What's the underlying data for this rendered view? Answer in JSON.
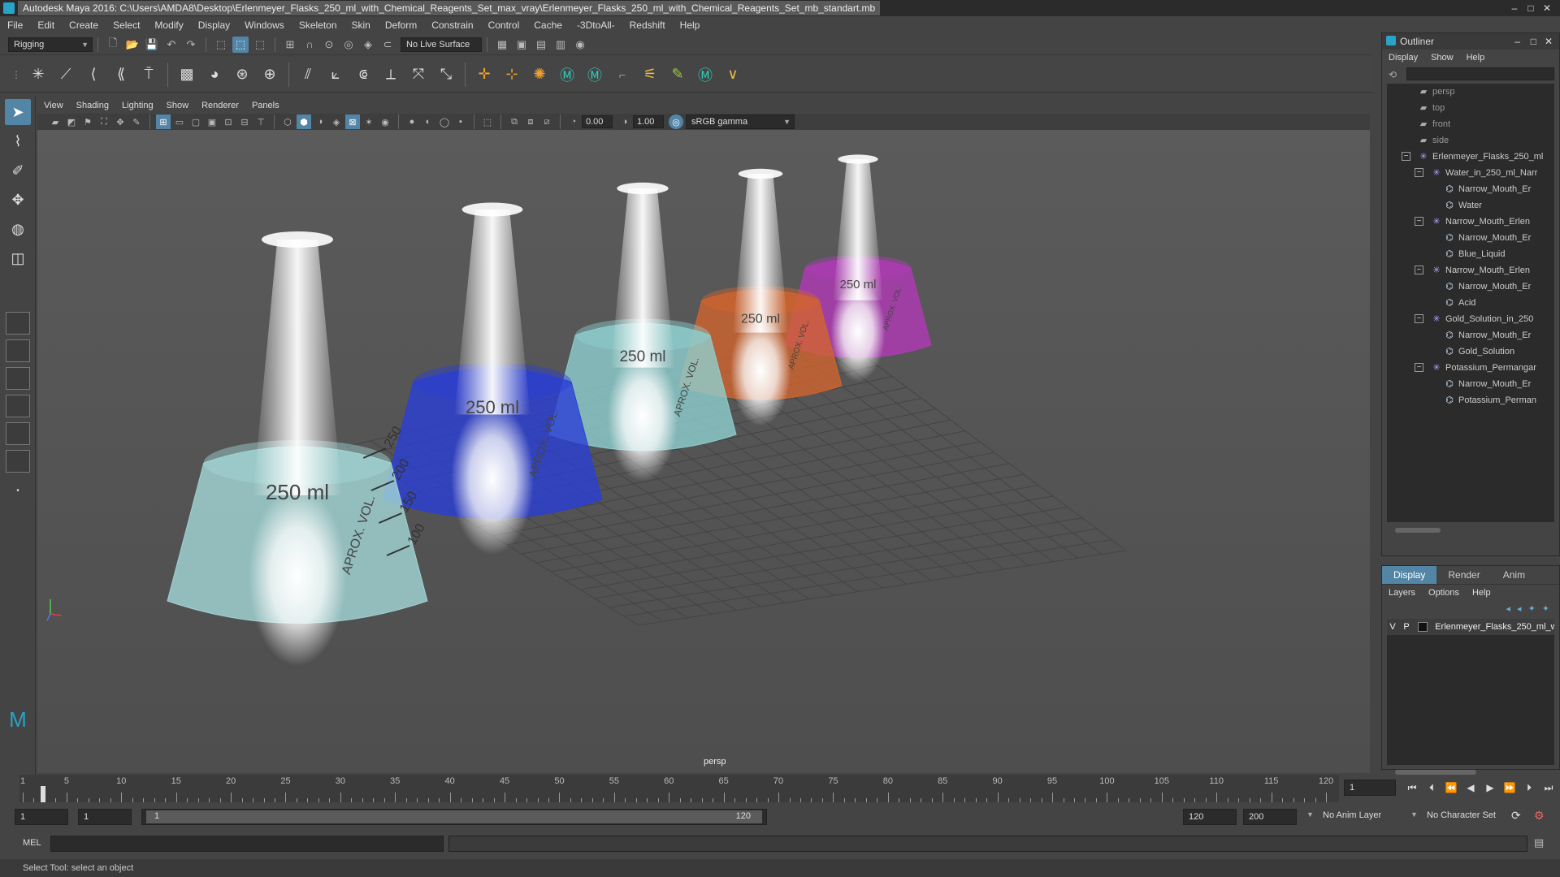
{
  "titlebar": {
    "title": "Autodesk Maya 2016: C:\\Users\\AMDA8\\Desktop\\Erlenmeyer_Flasks_250_ml_with_Chemical_Reagents_Set_max_vray\\Erlenmeyer_Flasks_250_ml_with_Chemical_Reagents_Set_mb_standart.mb",
    "min": "–",
    "max": "□",
    "close": "✕"
  },
  "menubar": [
    "File",
    "Edit",
    "Create",
    "Select",
    "Modify",
    "Display",
    "Windows",
    "Skeleton",
    "Skin",
    "Deform",
    "Constrain",
    "Control",
    "Cache",
    "-3DtoAll-",
    "Redshift",
    "Help"
  ],
  "statusline": {
    "menuset": "Rigging",
    "live_surface": "No Live Surface"
  },
  "viewport": {
    "menu": [
      "View",
      "Shading",
      "Lighting",
      "Show",
      "Renderer",
      "Panels"
    ],
    "exposure": "0.00",
    "gamma": "1.00",
    "colorspace": "sRGB gamma",
    "camera_label": "persp",
    "flasks": [
      {
        "volume_label": "250 ml",
        "vol_text": "APROX. VOL.",
        "marks": [
          "250",
          "200",
          "150",
          "100"
        ],
        "color": "#a4d8d8"
      },
      {
        "volume_label": "250 ml",
        "vol_text": "APROX. VOL.",
        "marks": [],
        "color": "#2b3fd6"
      },
      {
        "volume_label": "250 ml",
        "vol_text": "APROX. VOL.",
        "marks": [],
        "color": "#8fd0d0"
      },
      {
        "volume_label": "250 ml",
        "vol_text": "APROX. VOL.",
        "marks": [],
        "color": "#d2642e"
      },
      {
        "volume_label": "250 ml",
        "vol_text": "APROX. VOL.",
        "marks": [],
        "color": "#b23ab8"
      }
    ]
  },
  "outliner": {
    "title": "Outliner",
    "menu": [
      "Display",
      "Show",
      "Help"
    ],
    "items": [
      {
        "label": "persp",
        "type": "cam",
        "indent": 0
      },
      {
        "label": "top",
        "type": "cam",
        "indent": 0
      },
      {
        "label": "front",
        "type": "cam",
        "indent": 0
      },
      {
        "label": "side",
        "type": "cam",
        "indent": 0
      },
      {
        "label": "Erlenmeyer_Flasks_250_ml",
        "type": "grp",
        "indent": 0,
        "expander": "−"
      },
      {
        "label": "Water_in_250_ml_Narr",
        "type": "grp",
        "indent": 1,
        "expander": "−"
      },
      {
        "label": "Narrow_Mouth_Er",
        "type": "msh",
        "indent": 2
      },
      {
        "label": "Water",
        "type": "msh",
        "indent": 2
      },
      {
        "label": "Narrow_Mouth_Erlen",
        "type": "grp",
        "indent": 1,
        "expander": "−"
      },
      {
        "label": "Narrow_Mouth_Er",
        "type": "msh",
        "indent": 2
      },
      {
        "label": "Blue_Liquid",
        "type": "msh",
        "indent": 2
      },
      {
        "label": "Narrow_Mouth_Erlen",
        "type": "grp",
        "indent": 1,
        "expander": "−"
      },
      {
        "label": "Narrow_Mouth_Er",
        "type": "msh",
        "indent": 2
      },
      {
        "label": "Acid",
        "type": "msh",
        "indent": 2
      },
      {
        "label": "Gold_Solution_in_250",
        "type": "grp",
        "indent": 1,
        "expander": "−"
      },
      {
        "label": "Narrow_Mouth_Er",
        "type": "msh",
        "indent": 2
      },
      {
        "label": "Gold_Solution",
        "type": "msh",
        "indent": 2
      },
      {
        "label": "Potassium_Permangar",
        "type": "grp",
        "indent": 1,
        "expander": "−"
      },
      {
        "label": "Narrow_Mouth_Er",
        "type": "msh",
        "indent": 2
      },
      {
        "label": "Potassium_Perman",
        "type": "msh",
        "indent": 2
      }
    ]
  },
  "layer_editor": {
    "tabs": [
      "Display",
      "Render",
      "Anim"
    ],
    "menu": [
      "Layers",
      "Options",
      "Help"
    ],
    "layer": {
      "v": "V",
      "p": "P",
      "name": "Erlenmeyer_Flasks_250_ml_w"
    }
  },
  "timeslider": {
    "labels": [
      "1",
      "5",
      "10",
      "15",
      "20",
      "25",
      "30",
      "35",
      "40",
      "45",
      "50",
      "55",
      "60",
      "65",
      "70",
      "75",
      "80",
      "85",
      "90",
      "95",
      "100",
      "105",
      "110",
      "115",
      "120"
    ],
    "current_frame": "1"
  },
  "rangeslider": {
    "start": "1",
    "anim_start": "1",
    "range_start": "1",
    "range_end": "120",
    "end": "120",
    "anim_end": "200",
    "anim_layer": "No Anim Layer",
    "char_set": "No Character Set"
  },
  "cmdline": {
    "lang": "MEL"
  },
  "helpline": "Select Tool: select an object"
}
